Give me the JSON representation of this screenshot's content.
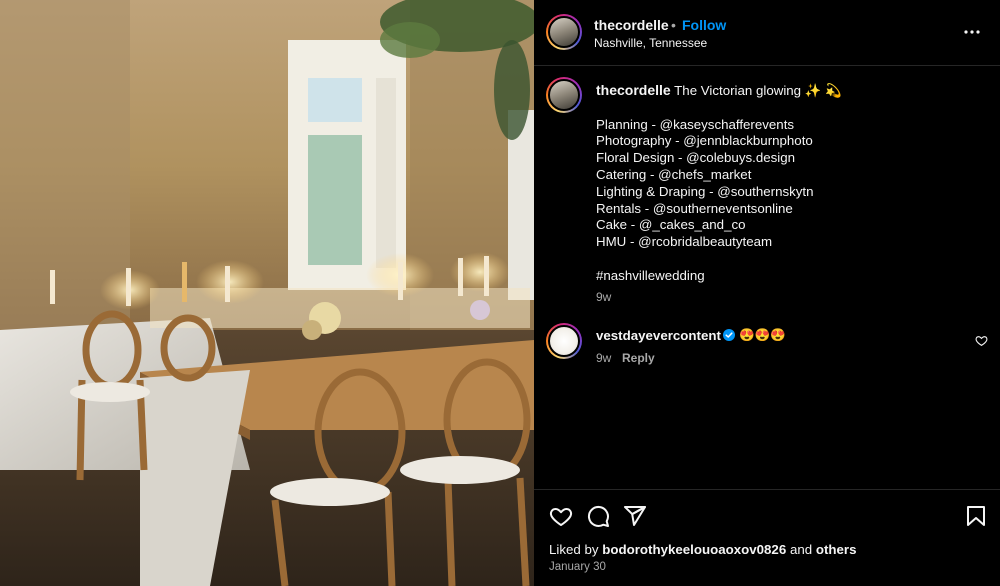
{
  "colors": {
    "background": "#000000",
    "text": "#f5f5f5",
    "muted": "#a8a8a8",
    "link": "#0095f6",
    "divider": "#262626",
    "verified": "#0095f6"
  },
  "post": {
    "photo_icon": "wedding-reception-photo"
  },
  "header": {
    "username": "thecordelle",
    "separator": "•",
    "follow_label": "Follow",
    "location": "Nashville, Tennessee",
    "more_icon": "more-horizontal-icon"
  },
  "caption": {
    "username": "thecordelle",
    "text": "The Victorian glowing ✨ 💫",
    "credits": [
      "Planning - @kaseyschafferevents",
      "Photography - @jennblackburnphoto",
      "Floral Design - @colebuys.design",
      "Catering - @chefs_market",
      "Lighting & Draping - @southernskytn",
      "Rentals - @southerneventsonline",
      "Cake - @_cakes_and_co",
      "HMU - @rcobridalbeautyteam"
    ],
    "hashtag": "#nashvillewedding",
    "time": "9w"
  },
  "comment": {
    "username": "vestdayevercontent",
    "verified_icon": "verified-badge-icon",
    "text": "😍😍😍",
    "time": "9w",
    "reply_label": "Reply",
    "like_icon": "heart-outline-icon"
  },
  "actions": {
    "like_icon": "heart-outline-icon",
    "comment_icon": "comment-bubble-icon",
    "share_icon": "paper-plane-icon",
    "save_icon": "bookmark-icon"
  },
  "likes": {
    "prefix": "Liked by",
    "user": "bodorothykeelouoaoxov0826",
    "joiner": "and",
    "others": "others"
  },
  "date": "January 30"
}
